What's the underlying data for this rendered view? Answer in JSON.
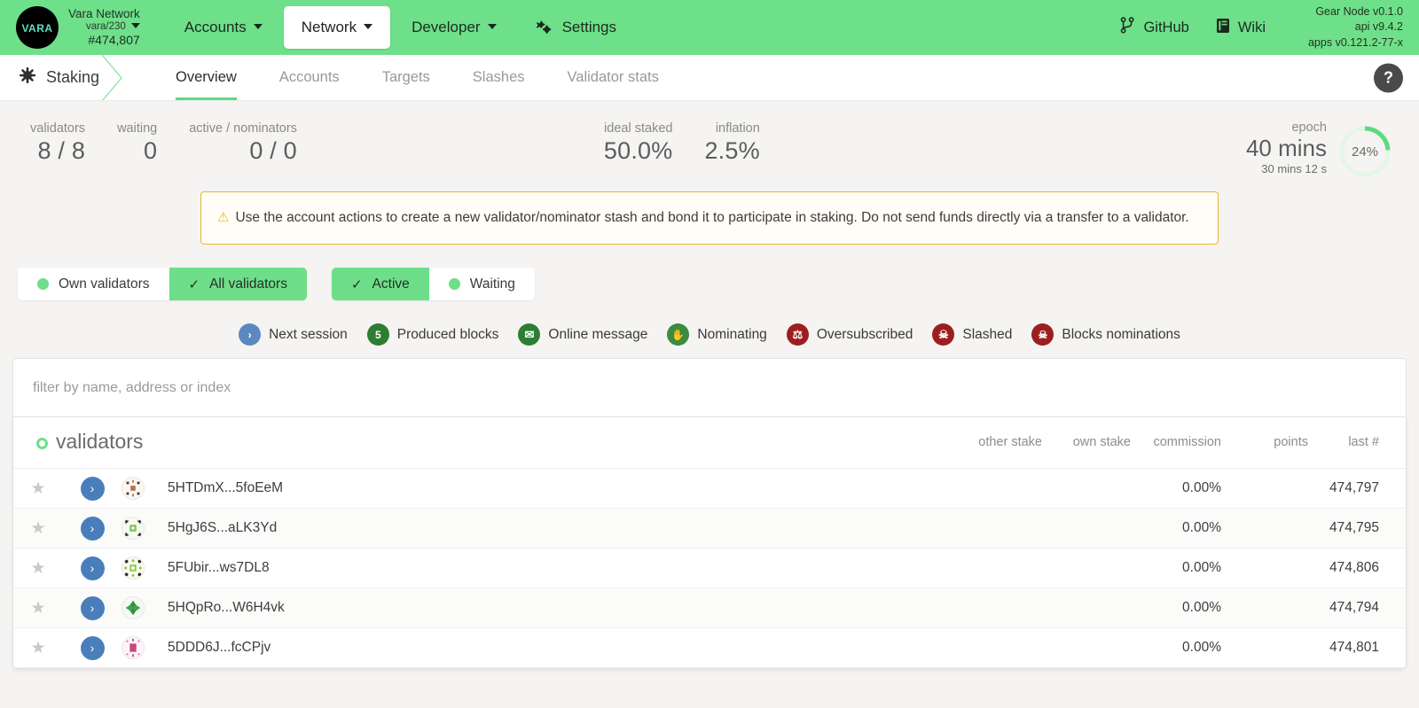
{
  "topbar": {
    "logo_text": "VARA",
    "brand": {
      "line1": "Vara Network",
      "line2": "vara/230",
      "line3": "#474,807"
    },
    "nav": [
      {
        "label": "Accounts",
        "active": false,
        "caret": true
      },
      {
        "label": "Network",
        "active": true,
        "caret": true
      },
      {
        "label": "Developer",
        "active": false,
        "caret": true
      },
      {
        "label": "Settings",
        "active": false,
        "caret": false
      }
    ],
    "github_label": "GitHub",
    "wiki_label": "Wiki",
    "version": {
      "node": "Gear Node v0.1.0",
      "api": "api v9.4.2",
      "apps": "apps v0.121.2-77-x"
    }
  },
  "tabbar": {
    "section": "Staking",
    "tabs": [
      {
        "label": "Overview",
        "active": true
      },
      {
        "label": "Accounts",
        "active": false
      },
      {
        "label": "Targets",
        "active": false
      },
      {
        "label": "Slashes",
        "active": false
      },
      {
        "label": "Validator stats",
        "active": false
      }
    ],
    "help_label": "?"
  },
  "summary": {
    "cards": [
      {
        "label": "validators",
        "value": "8 / 8"
      },
      {
        "label": "waiting",
        "value": "0"
      },
      {
        "label": "active / nominators",
        "value": "0 / 0"
      },
      {
        "label": "ideal staked",
        "value": "50.0%"
      },
      {
        "label": "inflation",
        "value": "2.5%"
      }
    ],
    "epoch": {
      "label": "epoch",
      "big": "40 mins",
      "sub": "30 mins 12 s",
      "percent": "24%",
      "percent_value": 24
    }
  },
  "warning": {
    "icon": "warning-triangle-icon",
    "text": "Use the account actions to create a new validator/nominator stash and bond it to participate in staking. Do not send funds directly via a transfer to a validator."
  },
  "toggles": {
    "group1": [
      {
        "label": "Own validators",
        "selected": false,
        "marker": "dot"
      },
      {
        "label": "All validators",
        "selected": true,
        "marker": "check"
      }
    ],
    "group2": [
      {
        "label": "Active",
        "selected": true,
        "marker": "check"
      },
      {
        "label": "Waiting",
        "selected": false,
        "marker": "dot"
      }
    ]
  },
  "legend": [
    {
      "label": "Next session",
      "icon": "chevron-right-icon",
      "glyph": "›",
      "color": "#5b88bf"
    },
    {
      "label": "Produced blocks",
      "icon": "produced-blocks-icon",
      "glyph": "5",
      "color": "#2e7d32"
    },
    {
      "label": "Online message",
      "icon": "envelope-icon",
      "glyph": "✉",
      "color": "#2e7d32"
    },
    {
      "label": "Nominating",
      "icon": "hand-icon",
      "glyph": "✋",
      "color": "#3a8c3e"
    },
    {
      "label": "Oversubscribed",
      "icon": "scales-icon",
      "glyph": "⚖",
      "color": "#9c1f1f"
    },
    {
      "label": "Slashed",
      "icon": "skull-icon",
      "glyph": "☠",
      "color": "#9c1f1f"
    },
    {
      "label": "Blocks nominations",
      "icon": "blocked-nominations-icon",
      "glyph": "☠",
      "color": "#9c1f1f"
    }
  ],
  "filter": {
    "placeholder": "filter by name, address or index",
    "value": ""
  },
  "table": {
    "title": "validators",
    "columns": [
      "other stake",
      "own stake",
      "commission",
      "points",
      "last #"
    ],
    "rows": [
      {
        "address": "5HTDmX...5foEeM",
        "other_stake": "",
        "own_stake": "",
        "commission": "0.00%",
        "points": "",
        "last": "474,797",
        "ident_bg": "#fdf6f0",
        "ident_fg": "#b4704e"
      },
      {
        "address": "5HgJ6S...aLK3Yd",
        "other_stake": "",
        "own_stake": "",
        "commission": "0.00%",
        "points": "",
        "last": "474,795",
        "ident_bg": "#f4faf0",
        "ident_fg": "#7dbd4f"
      },
      {
        "address": "5FUbir...ws7DL8",
        "other_stake": "",
        "own_stake": "",
        "commission": "0.00%",
        "points": "",
        "last": "474,806",
        "ident_bg": "#f7fbf1",
        "ident_fg": "#8cc63f"
      },
      {
        "address": "5HQpRo...W6H4vk",
        "other_stake": "",
        "own_stake": "",
        "commission": "0.00%",
        "points": "",
        "last": "474,794",
        "ident_bg": "#f2faf2",
        "ident_fg": "#2f8f3f"
      },
      {
        "address": "5DDD6J...fcCPjv",
        "other_stake": "",
        "own_stake": "",
        "commission": "0.00%",
        "points": "",
        "last": "474,801",
        "ident_bg": "#fdf2f6",
        "ident_fg": "#c24a7a"
      }
    ]
  },
  "colors": {
    "brand_green": "#6ee08a",
    "accent_green": "#5fd97f",
    "warning_border": "#e8b730",
    "arrow_blue": "#4a7ebb"
  }
}
